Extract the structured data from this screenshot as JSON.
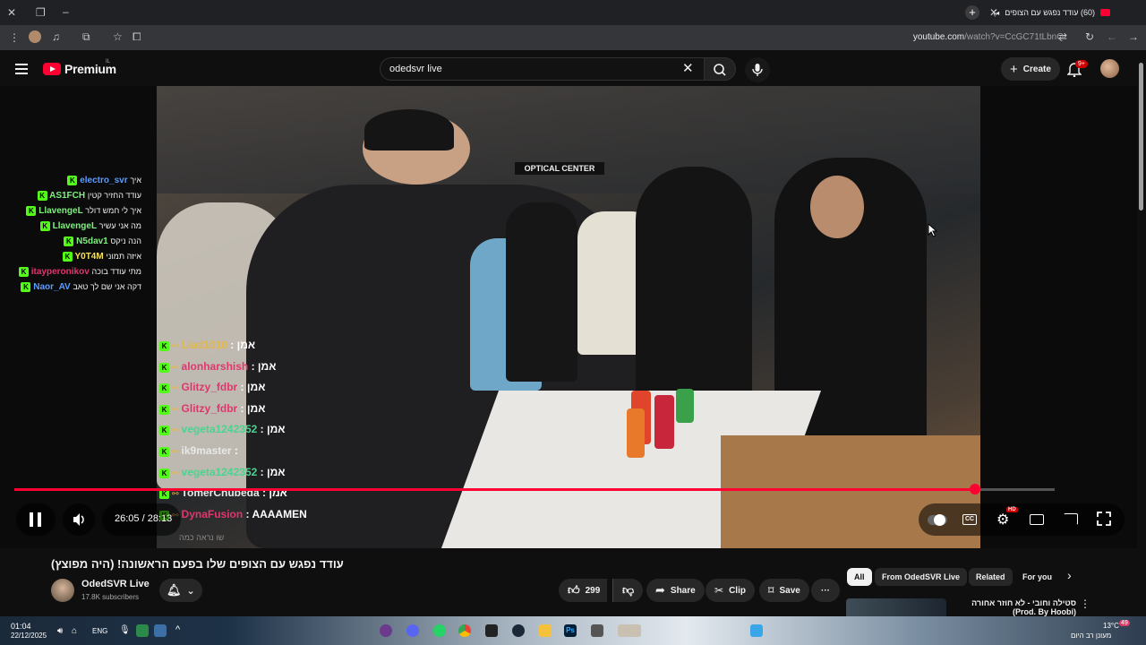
{
  "browser": {
    "tab_title": "(60) עודד נפגש עם הצופים",
    "url_host": "youtube.com",
    "url_path": "/watch?v=CcGC71tLbnQ"
  },
  "header": {
    "logo_text": "Premium",
    "logo_country": "IL",
    "search_value": "odedsvr live",
    "create_label": "Create",
    "notifications_badge": "9+"
  },
  "kick_chat": [
    {
      "user": "electro_svr",
      "msg": "איך",
      "user_color": "#5b9cff"
    },
    {
      "user": "AS1FCH",
      "msg": "עודד החזיר קטין",
      "user_color": "#7cf27c"
    },
    {
      "user": "LlavengeL",
      "msg": "איך לי חמש דולר",
      "user_color": "#7cf27c"
    },
    {
      "user": "LlavengeL",
      "msg": "מה אני עשיר",
      "user_color": "#7cf27c"
    },
    {
      "user": "N5dav1",
      "msg": "הנה ניקס",
      "user_color": "#7cf27c"
    },
    {
      "user": "Y0T4M",
      "msg": "איזה תמוני",
      "user_color": "#f5e25a"
    },
    {
      "user": "itayperonikov",
      "msg": "מתי עודד בוכה",
      "user_color": "#e0366c"
    },
    {
      "user": "Naor_AV",
      "msg": "דקה אני שם לך טאב",
      "user_color": "#5b9cff"
    }
  ],
  "overlay_chat": [
    {
      "user": "Liad1010",
      "msg": "אמן",
      "color": "#e2b84a"
    },
    {
      "user": "alonharshish",
      "msg": "אמן",
      "color": "#e0366c"
    },
    {
      "user": "Glitzy_fdbr",
      "msg": "אמן",
      "color": "#e0366c"
    },
    {
      "user": "Glitzy_fdbr",
      "msg": "אמן",
      "color": "#e0366c"
    },
    {
      "user": "vegeta1242352",
      "msg": "אמן",
      "color": "#4bd38f"
    },
    {
      "user": "ik9master",
      "msg": "",
      "color": "#e8e8e8"
    },
    {
      "user": "vegeta1242352",
      "msg": "אמן",
      "color": "#4bd38f"
    },
    {
      "user": "TomerChubeda",
      "msg": "אמן",
      "color": "#e8e8e8"
    },
    {
      "user": "DynaFusion",
      "msg": "AAAAMEN",
      "color": "#e0366c"
    }
  ],
  "overlay_faded": "שו נראה כמה",
  "player": {
    "current_time": "26:05",
    "duration": "28:13",
    "time_display": "26:05 / 28:13",
    "progress": 0.9236,
    "quality_badge": "HD"
  },
  "video": {
    "title": "עודד נפגש עם הצופים שלו בפעם הראשונה! (היה מפוצץ)",
    "channel_name": "OdedSVR Live",
    "subscribers": "17.8K subscribers",
    "likes": "299",
    "share_label": "Share",
    "clip_label": "Clip",
    "save_label": "Save"
  },
  "chips": [
    "All",
    "From OdedSVR Live",
    "Related",
    "For you"
  ],
  "recommendation": {
    "title": "סטילה וחובי - לא חוזר אחורה (Prod. By Hoobi)"
  },
  "taskbar": {
    "time": "01:04",
    "date": "22/12/2025",
    "language": "ENG",
    "weather_temp": "13°C",
    "weather_desc": "מעונן רב היום",
    "notif_count": "49"
  }
}
